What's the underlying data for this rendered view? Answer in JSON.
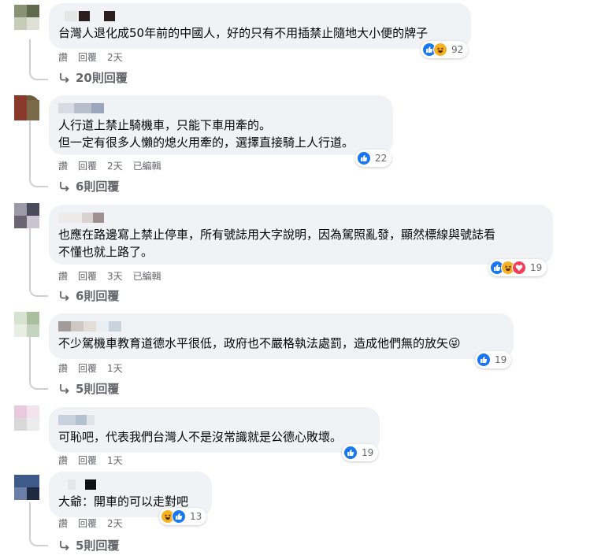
{
  "comments": [
    {
      "text": "台灣人退化成50年前的中國人，好的只有不用插禁止隨地大小便的牌子",
      "reactions": [
        "like",
        "haha"
      ],
      "reaction_count": "92",
      "actions": {
        "like": "讚",
        "reply": "回覆",
        "time": "2天"
      },
      "replies_label": "20則回覆"
    },
    {
      "text": "人行道上禁止騎機車，只能下車用牽的。\n但一定有很多人懶的熄火用牽的，選擇直接騎上人行道。",
      "reactions": [
        "like"
      ],
      "reaction_count": "22",
      "actions": {
        "like": "讚",
        "reply": "回覆",
        "time": "2天",
        "edited": "已編輯"
      },
      "replies_label": "6則回覆"
    },
    {
      "text": "也應在路邊寫上禁止停車，所有號誌用大字說明，因為駕照亂發，顯然標線與號誌看\n不懂也就上路了。",
      "reactions": [
        "like",
        "haha",
        "love"
      ],
      "reaction_count": "19",
      "actions": {
        "like": "讚",
        "reply": "回覆",
        "time": "3天",
        "edited": "已編輯"
      },
      "replies_label": "6則回覆"
    },
    {
      "text": "不少駕機車教育道德水平很低，政府也不嚴格執法處罰，造成他們無的放矢",
      "emoji": "😜",
      "reactions": [
        "like"
      ],
      "reaction_count": "19",
      "actions": {
        "like": "讚",
        "reply": "回覆",
        "time": "1天"
      },
      "replies_label": "5則回覆"
    },
    {
      "text": "可恥吧，代表我們台灣人不是沒常識就是公德心敗壞。",
      "reactions": [
        "like"
      ],
      "reaction_count": "19",
      "actions": {
        "like": "讚",
        "reply": "回覆",
        "time": "1天"
      }
    },
    {
      "text": "大爺：開車的可以走對吧",
      "reactions": [
        "haha",
        "like"
      ],
      "reaction_count": "13",
      "actions": {
        "like": "讚",
        "reply": "回覆",
        "time": "2天"
      },
      "replies_label": "5則回覆"
    }
  ],
  "colors": {
    "like": "#1877f2",
    "haha": "#f7b125",
    "love": "#f33e58",
    "bubble": "#f0f2f5",
    "meta": "#65676b"
  },
  "icons": {
    "reply_arrow": "reply-arrow-icon",
    "like": "like-icon",
    "haha": "haha-icon",
    "love": "love-icon"
  }
}
